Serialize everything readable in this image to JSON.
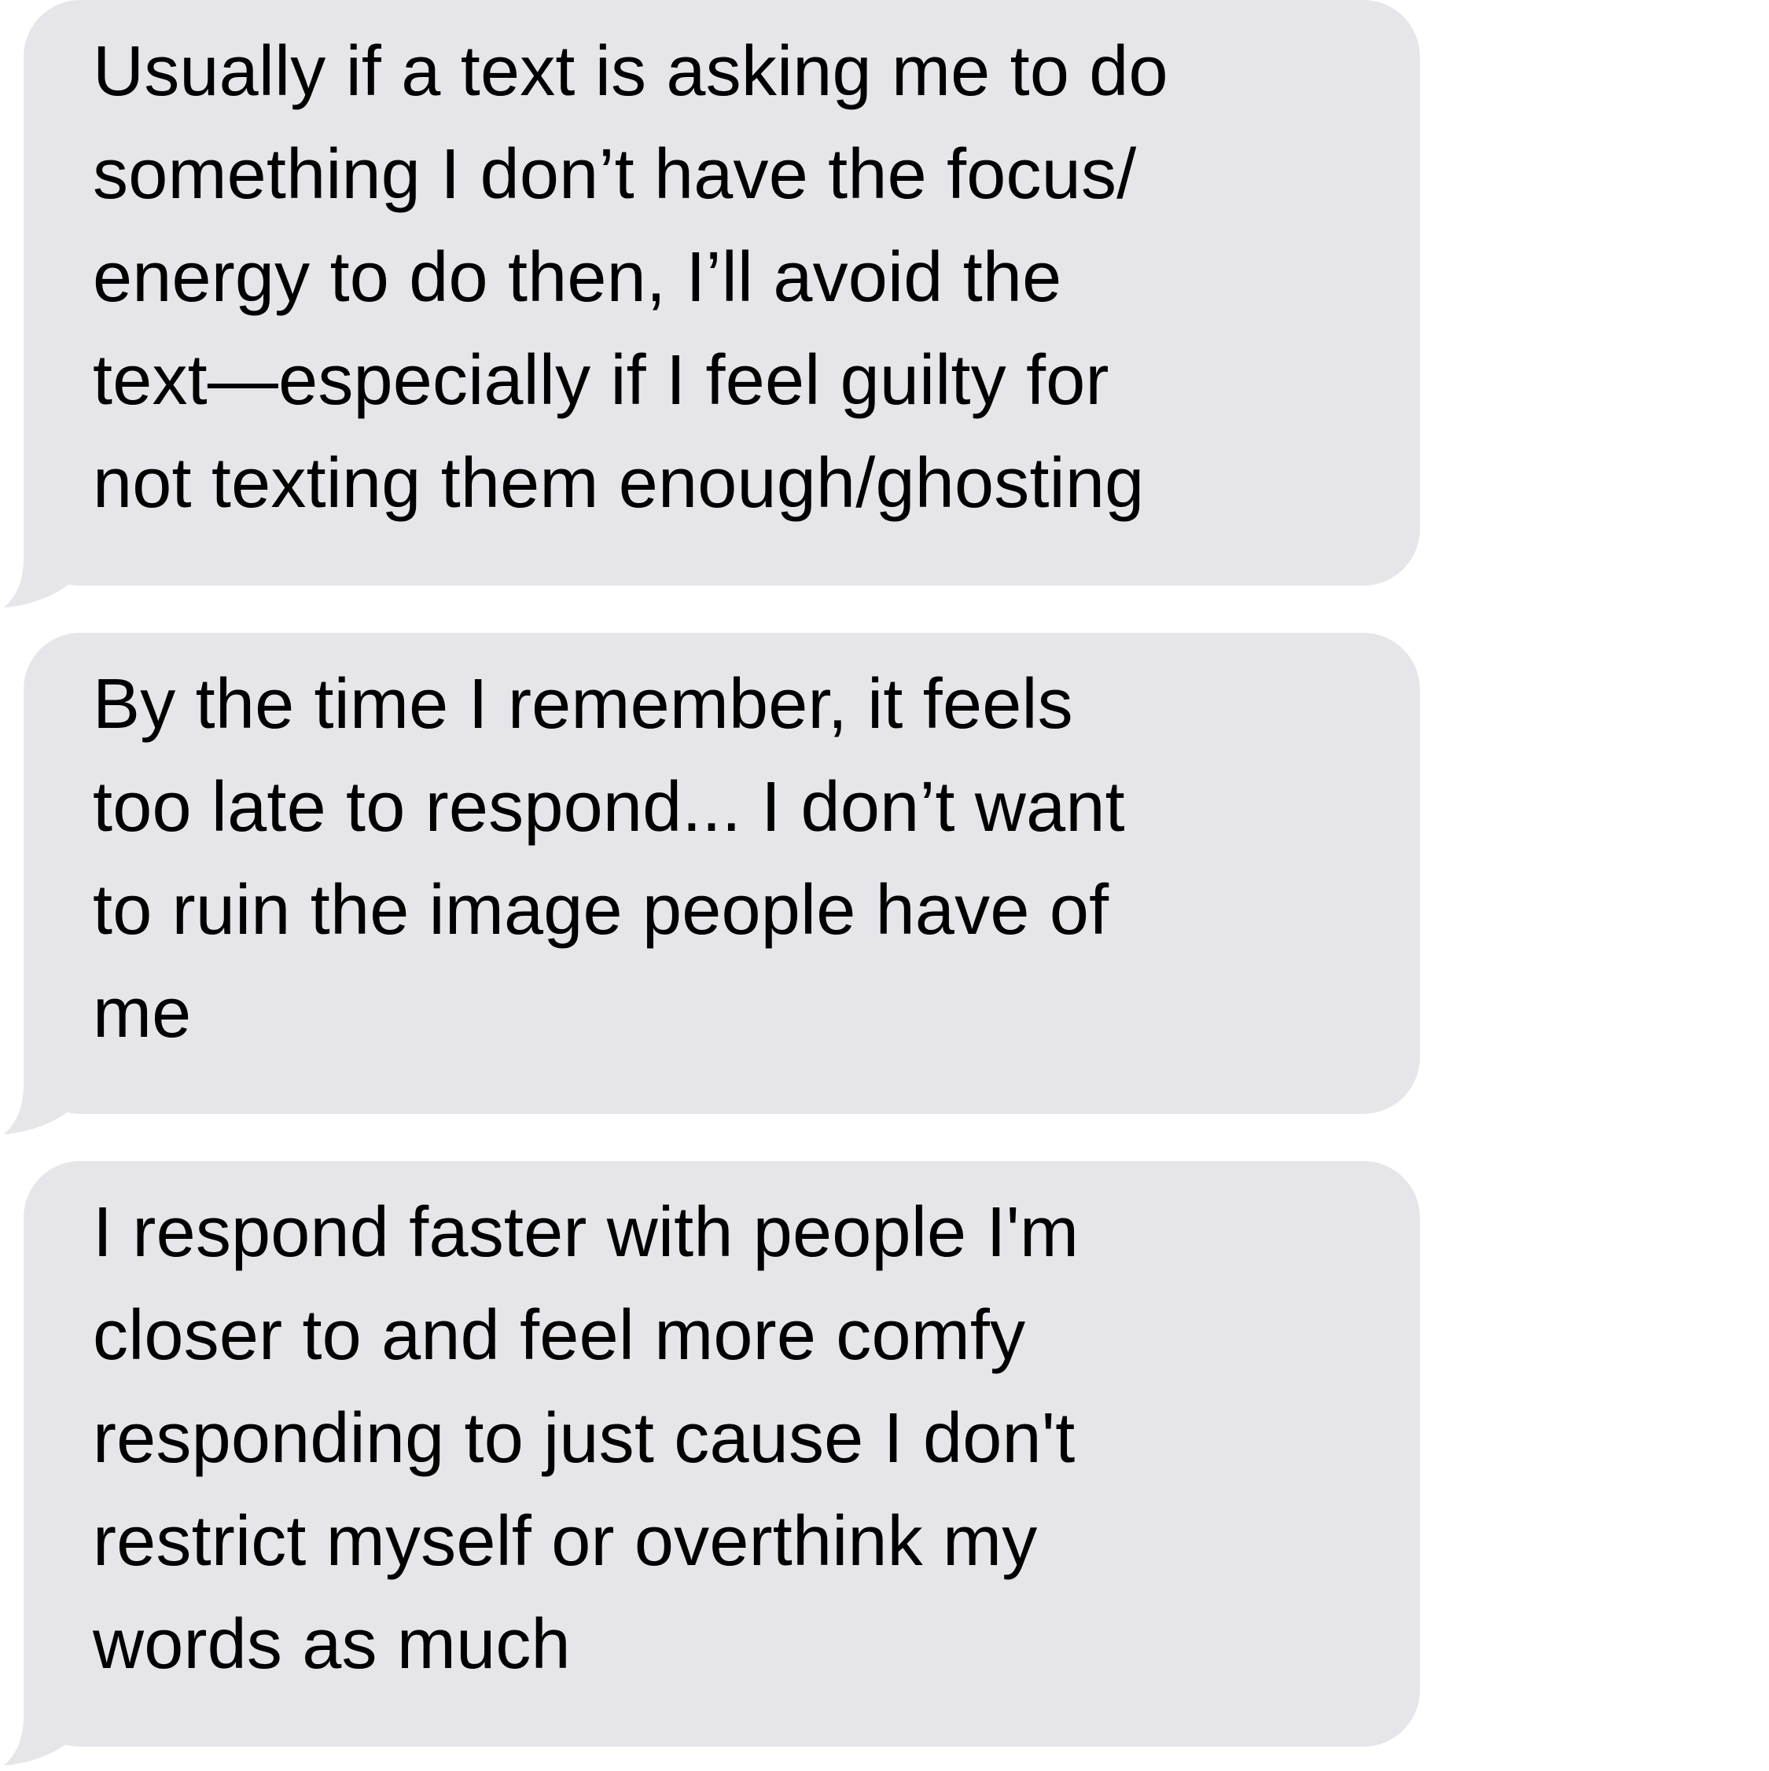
{
  "thread": {
    "bubble_color": "#e5e5ea",
    "text_color": "#000000",
    "messages": [
      {
        "lines": [
          "Usually if a text is asking me to do",
          "something I don’t have the focus/",
          "energy to do then, I’ll avoid the",
          "text—especially if I feel guilty for",
          "not texting them enough/ghosting"
        ]
      },
      {
        "lines": [
          "By the time I remember, it feels",
          "too late to respond... I don’t want",
          "to ruin the image people have of",
          "me"
        ]
      },
      {
        "lines": [
          "I respond faster with people I'm",
          "closer to and feel more comfy",
          "responding to just cause I don't",
          "restrict myself or overthink my",
          "words as much"
        ]
      }
    ]
  }
}
